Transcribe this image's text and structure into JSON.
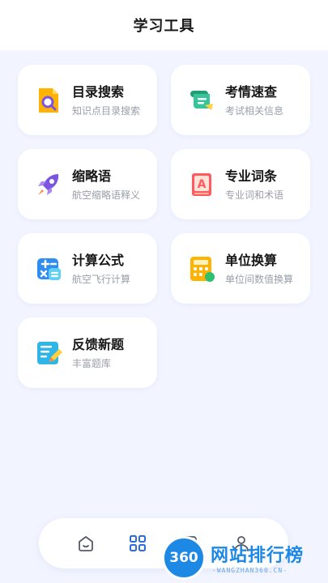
{
  "header": {
    "title": "学习工具"
  },
  "tools": [
    {
      "name": "目录搜索",
      "desc": "知识点目录搜索",
      "icon": "search-document-icon"
    },
    {
      "name": "考情速查",
      "desc": "考试相关信息",
      "icon": "scroll-icon"
    },
    {
      "name": "缩略语",
      "desc": "航空缩略语释义",
      "icon": "rocket-icon"
    },
    {
      "name": "专业词条",
      "desc": "专业词和术语",
      "icon": "letter-a-book-icon"
    },
    {
      "name": "计算公式",
      "desc": "航空飞行计算",
      "icon": "math-symbols-icon"
    },
    {
      "name": "单位换算",
      "desc": "单位间数值换算",
      "icon": "calculator-icon"
    },
    {
      "name": "反馈新题",
      "desc": "丰富题库",
      "icon": "notepad-pencil-icon"
    }
  ],
  "tabbar": {
    "tabs": [
      {
        "icon": "home-icon",
        "active": false
      },
      {
        "icon": "grid-icon",
        "active": true
      },
      {
        "icon": "square-icon",
        "active": false
      },
      {
        "icon": "profile-icon",
        "active": false
      }
    ]
  },
  "watermark": {
    "badge": "360",
    "title": "网站排行榜",
    "subtitle": "-WANGZHAN360.CN-"
  },
  "colors": {
    "accent": "#1e88e5",
    "background": "#f2f5ff",
    "active_tab": "#2d6cdf"
  }
}
